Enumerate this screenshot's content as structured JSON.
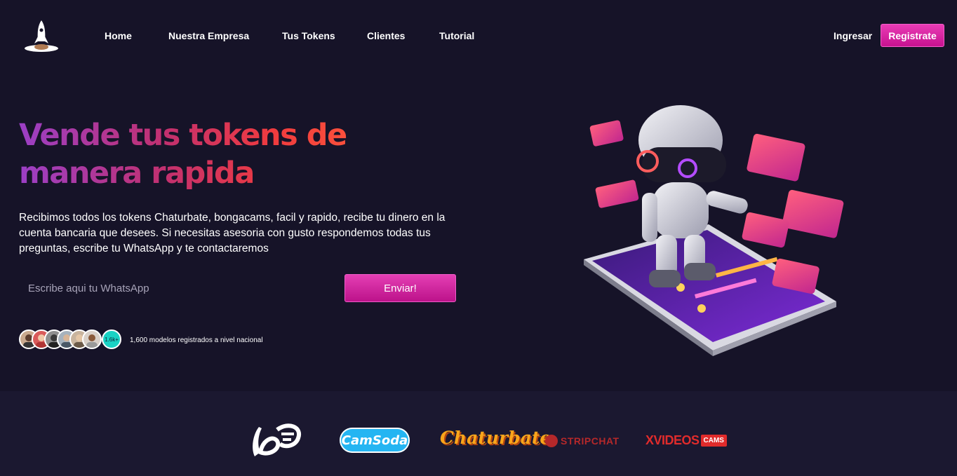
{
  "nav": {
    "logo": "rocket-icon",
    "links": [
      "Home",
      "Nuestra Empresa",
      "Tus Tokens",
      "Clientes",
      "Tutorial"
    ],
    "login": "Ingresar",
    "register": "Registrate"
  },
  "hero": {
    "title_line1": "Vende tus tokens de",
    "title_line2": "manera rapida",
    "description": "Recibimos todos los tokens Chaturbate, bongacams, facil y rapido, recibe tu dinero en la cuenta bancaria que desees. Si necesitas asesoria con gusto respondemos todas tus preguntas, escribe tu WhatsApp y te contactaremos",
    "input_placeholder": "Escribe aqui tu WhatsApp",
    "send_button": "Enviar!",
    "avatar_count": "1.6k+",
    "models_text": "1,600 modelos registrados a nivel nacional"
  },
  "brands": {
    "camsoda": "CamSoda",
    "chaturbate": "Chaturbate",
    "stripchat": "STRIPCHAT",
    "xvideos": "XVIDEOS",
    "xvideos_badge": "CAMS"
  },
  "colors": {
    "accent": "#d9219e",
    "background": "#161328",
    "brand_bar": "#1b1830"
  }
}
